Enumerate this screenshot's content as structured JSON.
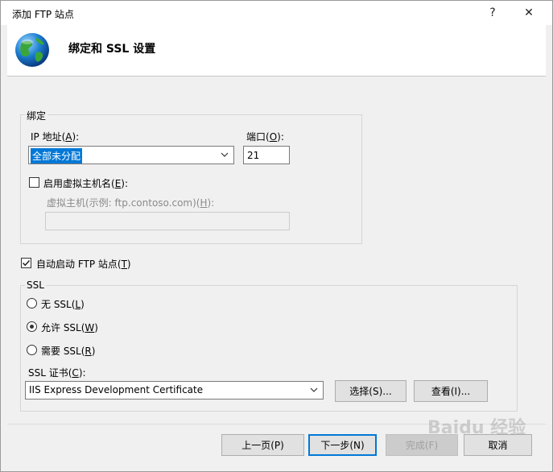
{
  "window": {
    "title": "添加 FTP 站点",
    "help_label": "?",
    "close_label": "✕"
  },
  "header": {
    "title": "绑定和 SSL 设置",
    "icon": "globe-icon"
  },
  "binding": {
    "legend": "绑定",
    "ip_label": "IP 地址(",
    "ip_key": "A",
    "ip_label_end": "):",
    "ip_value": "全部未分配",
    "port_label": "端口(",
    "port_key": "O",
    "port_label_end": "):",
    "port_value": "21",
    "vhost_checkbox_label": "启用虚拟主机名(",
    "vhost_key": "E",
    "vhost_label_end": "):",
    "vhost_checked": false,
    "host_label": "虚拟主机(示例: ftp.contoso.com)(",
    "host_key": "H",
    "host_label_end": "):",
    "host_value": ""
  },
  "autostart": {
    "label": "自动启动 FTP 站点(",
    "key": "T",
    "label_end": ")",
    "checked": true
  },
  "ssl": {
    "legend": "SSL",
    "options": [
      {
        "label": "无 SSL(",
        "key": "L",
        "end": ")",
        "selected": false
      },
      {
        "label": "允许 SSL(",
        "key": "W",
        "end": ")",
        "selected": true
      },
      {
        "label": "需要 SSL(",
        "key": "R",
        "end": ")",
        "selected": false
      }
    ],
    "cert_label": "SSL 证书(",
    "cert_key": "C",
    "cert_label_end": "):",
    "cert_value": "IIS Express Development Certificate",
    "select_button": "选择(S)...",
    "view_button": "查看(I)..."
  },
  "footer": {
    "prev_button": "上一页(P)",
    "next_button": "下一步(N)",
    "finish_button": "完成(F)",
    "cancel_button": "取消"
  },
  "watermark": "Baidu 经验",
  "colors": {
    "accent": "#0078d7",
    "dialog_bg": "#f0f0f0"
  }
}
